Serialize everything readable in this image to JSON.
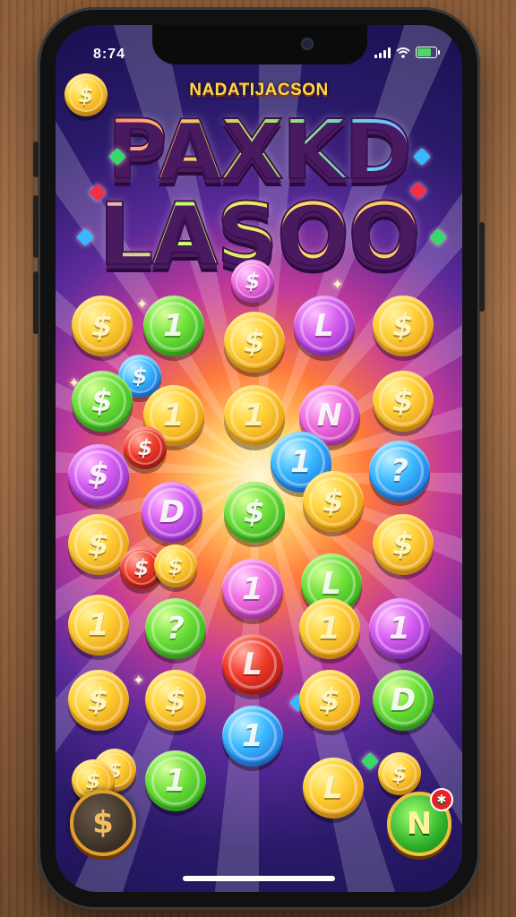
{
  "status_bar": {
    "time": "8:74",
    "battery_color": "#4cd964",
    "battery_level": 0.9
  },
  "header": {
    "subtitle": "NADATIJACSON",
    "title_line1": "PAXKD",
    "title_line2": "LASOO"
  },
  "board": {
    "coins": [
      {
        "symbol": "$",
        "color": "pink"
      },
      {
        "symbol": "$",
        "color": "gold"
      },
      {
        "symbol": "1",
        "color": "green"
      },
      {
        "symbol": "$",
        "color": "gold"
      },
      {
        "symbol": "L",
        "color": "purple"
      },
      {
        "symbol": "$",
        "color": "gold"
      },
      {
        "symbol": "$",
        "color": "blue"
      },
      {
        "symbol": "$",
        "color": "green"
      },
      {
        "symbol": "1",
        "color": "gold"
      },
      {
        "symbol": "1",
        "color": "gold"
      },
      {
        "symbol": "N",
        "color": "pink"
      },
      {
        "symbol": "$",
        "color": "gold"
      },
      {
        "symbol": "$",
        "color": "red"
      },
      {
        "symbol": "1",
        "color": "blue"
      },
      {
        "symbol": "$",
        "color": "purple"
      },
      {
        "symbol": "?",
        "color": "blue"
      },
      {
        "symbol": "D",
        "color": "purple"
      },
      {
        "symbol": "$",
        "color": "green"
      },
      {
        "symbol": "$",
        "color": "gold"
      },
      {
        "symbol": "$",
        "color": "gold"
      },
      {
        "symbol": "$",
        "color": "gold"
      },
      {
        "symbol": "$",
        "color": "red"
      },
      {
        "symbol": "1",
        "color": "pink"
      },
      {
        "symbol": "L",
        "color": "green"
      },
      {
        "symbol": "$",
        "color": "gold"
      },
      {
        "symbol": "1",
        "color": "gold"
      },
      {
        "symbol": "?",
        "color": "green"
      },
      {
        "symbol": "1",
        "color": "gold"
      },
      {
        "symbol": "1",
        "color": "purple"
      },
      {
        "symbol": "L",
        "color": "red"
      },
      {
        "symbol": "$",
        "color": "gold"
      },
      {
        "symbol": "$",
        "color": "gold"
      },
      {
        "symbol": "$",
        "color": "gold"
      },
      {
        "symbol": "D",
        "color": "green"
      },
      {
        "symbol": "1",
        "color": "blue"
      },
      {
        "symbol": "1",
        "color": "green"
      },
      {
        "symbol": "$",
        "color": "gold"
      },
      {
        "symbol": "L",
        "color": "gold"
      },
      {
        "symbol": "$",
        "color": "gold"
      }
    ]
  },
  "buttons": {
    "bank_symbol": "$",
    "n_label": "N",
    "n_badge": "✱"
  },
  "colors": {
    "gold": "#ffd23a",
    "green": "#6ee03a",
    "purple": "#d45cf0",
    "pink": "#f06ce0",
    "blue": "#3ab8ff",
    "red": "#f03a2a"
  }
}
